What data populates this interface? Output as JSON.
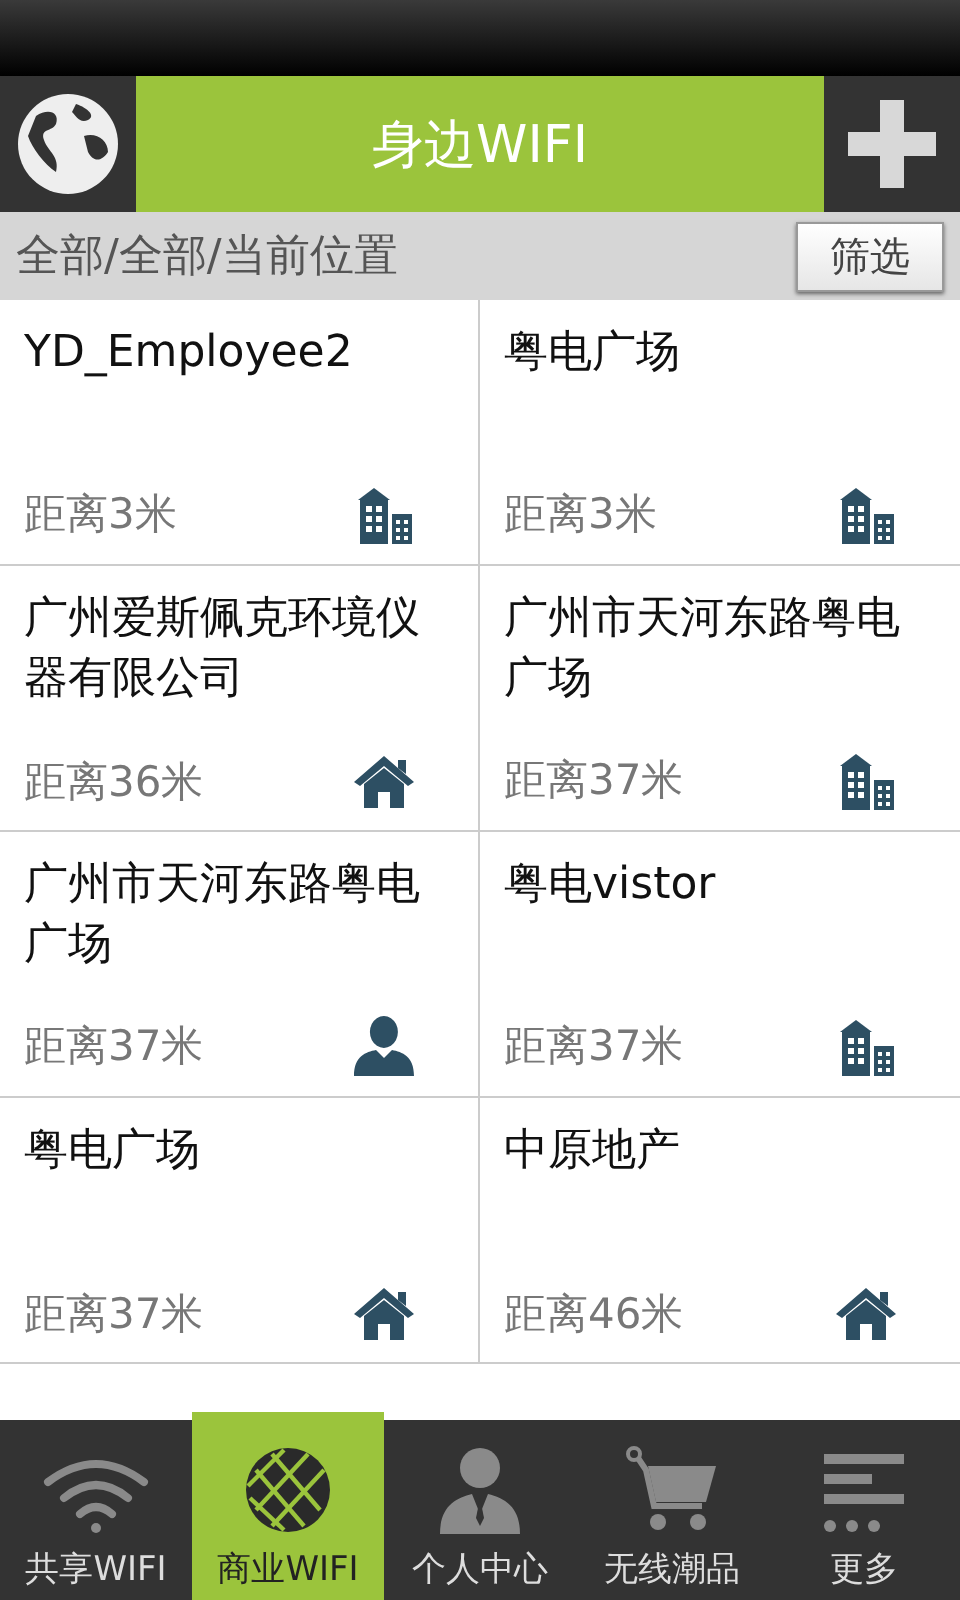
{
  "header": {
    "title": "身边WIFI"
  },
  "filter_bar": {
    "path": "全部/全部/当前位置",
    "button": "筛选"
  },
  "hotspots": [
    {
      "name": "YD_Employee2",
      "distance": "距离3米",
      "kind": "building"
    },
    {
      "name": "粤电广场",
      "distance": "距离3米",
      "kind": "building"
    },
    {
      "name": "广州爱斯佩克环境仪器有限公司",
      "distance": "距离36米",
      "kind": "home"
    },
    {
      "name": "广州市天河东路粤电广场",
      "distance": "距离37米",
      "kind": "building"
    },
    {
      "name": "广州市天河东路粤电广场",
      "distance": "距离37米",
      "kind": "person"
    },
    {
      "name": "粤电vistor",
      "distance": "距离37米",
      "kind": "building"
    },
    {
      "name": "粤电广场",
      "distance": "距离37米",
      "kind": "home"
    },
    {
      "name": "中原地产",
      "distance": "距离46米",
      "kind": "home"
    }
  ],
  "tabs": [
    {
      "label": "共享WIFI",
      "kind": "wifi",
      "selected": false
    },
    {
      "label": "商业WIFI",
      "kind": "globe",
      "selected": true
    },
    {
      "label": "个人中心",
      "kind": "person",
      "selected": false
    },
    {
      "label": "无线潮品",
      "kind": "cart",
      "selected": false
    },
    {
      "label": "更多",
      "kind": "more",
      "selected": false
    }
  ]
}
